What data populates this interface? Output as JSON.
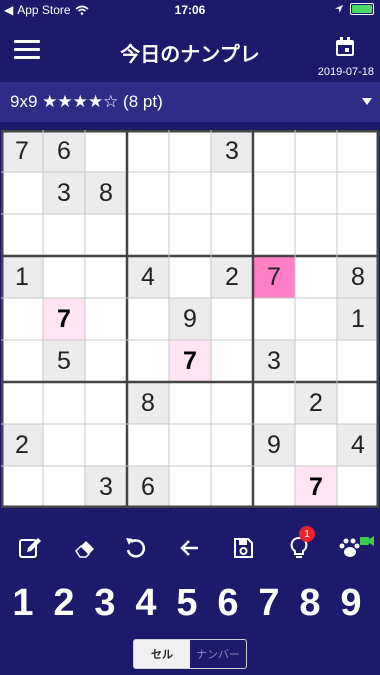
{
  "status": {
    "carrier": "App Store",
    "time": "17:06"
  },
  "header": {
    "title": "今日のナンプレ",
    "date": "2019-07-18"
  },
  "difficulty": {
    "label": "9x9 ★★★★☆ (8 pt)"
  },
  "board": {
    "given_cells": [
      [
        0,
        0
      ],
      [
        0,
        1
      ],
      [
        0,
        5
      ],
      [
        1,
        1
      ],
      [
        1,
        2
      ],
      [
        3,
        0
      ],
      [
        3,
        3
      ],
      [
        3,
        5
      ],
      [
        3,
        6
      ],
      [
        3,
        8
      ],
      [
        4,
        4
      ],
      [
        4,
        8
      ],
      [
        5,
        1
      ],
      [
        5,
        6
      ],
      [
        6,
        3
      ],
      [
        6,
        7
      ],
      [
        7,
        0
      ],
      [
        7,
        6
      ],
      [
        7,
        8
      ],
      [
        8,
        2
      ],
      [
        8,
        3
      ]
    ],
    "highlight_cells": [
      [
        4,
        1
      ],
      [
        5,
        4
      ],
      [
        8,
        7
      ]
    ],
    "selected_cell": [
      3,
      6
    ],
    "rows": [
      [
        "7",
        "6",
        "",
        "",
        "",
        "3",
        "",
        "",
        ""
      ],
      [
        "",
        "3",
        "8",
        "",
        "",
        "",
        "",
        "",
        ""
      ],
      [
        "",
        "",
        "",
        "",
        "",
        "",
        "",
        "",
        ""
      ],
      [
        "1",
        "",
        "",
        "4",
        "",
        "2",
        "7",
        "",
        "8"
      ],
      [
        "",
        "7",
        "",
        "",
        "9",
        "",
        "",
        "",
        "1"
      ],
      [
        "",
        "5",
        "",
        "",
        "7",
        "",
        "3",
        "",
        ""
      ],
      [
        "",
        "",
        "",
        "8",
        "",
        "",
        "",
        "2",
        ""
      ],
      [
        "2",
        "",
        "",
        "",
        "",
        "",
        "9",
        "",
        "4"
      ],
      [
        "",
        "",
        "3",
        "6",
        "",
        "",
        "",
        "7",
        ""
      ]
    ]
  },
  "tools": {
    "hint_badge": "1",
    "items": [
      "edit-icon",
      "eraser-icon",
      "undo-icon",
      "back-arrow-icon",
      "save-icon",
      "hint-lightbulb-icon",
      "paw-video-icon"
    ]
  },
  "numbers": [
    "1",
    "2",
    "3",
    "4",
    "5",
    "6",
    "7",
    "8",
    "9"
  ],
  "mode": {
    "cell": "セル",
    "number": "ナンバー"
  },
  "colors": {
    "background": "#1d1a6b",
    "bar": "#2f2c85",
    "selected": "#ff7fc4",
    "highlight": "#ffe4f3",
    "given": "#ececec"
  }
}
